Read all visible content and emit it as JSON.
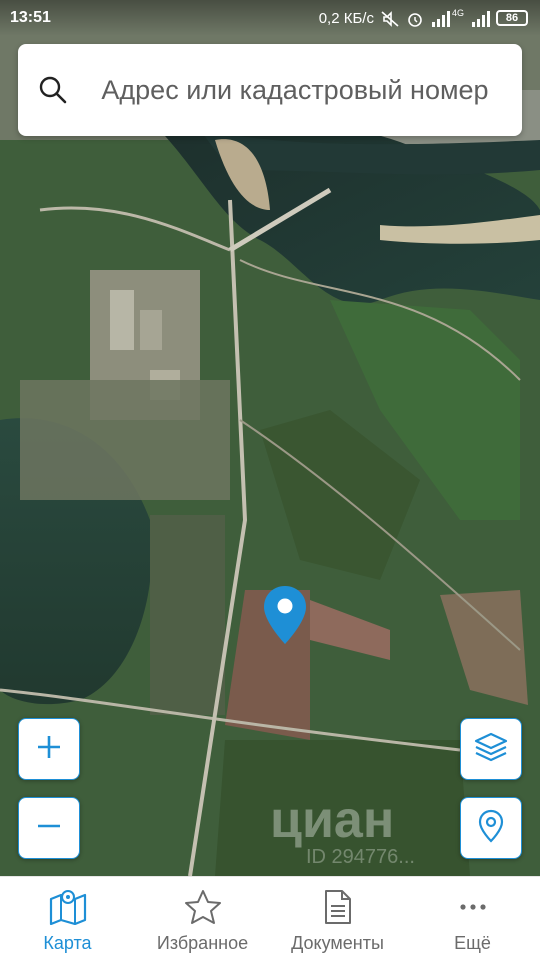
{
  "status_bar": {
    "time": "13:51",
    "network_speed": "0,2 КБ/с",
    "signal_label": "4G",
    "battery": "86"
  },
  "search": {
    "placeholder": "Адрес или кадастровый номер"
  },
  "map": {
    "watermark": "циан",
    "watermark_id": "ID 294776..."
  },
  "controls": {
    "zoom_in_icon": "plus-icon",
    "zoom_out_icon": "minus-icon",
    "layers_icon": "layers-icon",
    "locate_icon": "location-pin-icon"
  },
  "bottom_nav": {
    "items": [
      {
        "label": "Карта",
        "icon": "map-icon",
        "active": true
      },
      {
        "label": "Избранное",
        "icon": "star-icon",
        "active": false
      },
      {
        "label": "Документы",
        "icon": "document-icon",
        "active": false
      },
      {
        "label": "Ещё",
        "icon": "more-icon",
        "active": false
      }
    ]
  },
  "colors": {
    "accent": "#1e8fd6",
    "inactive": "#6b6b6b"
  }
}
